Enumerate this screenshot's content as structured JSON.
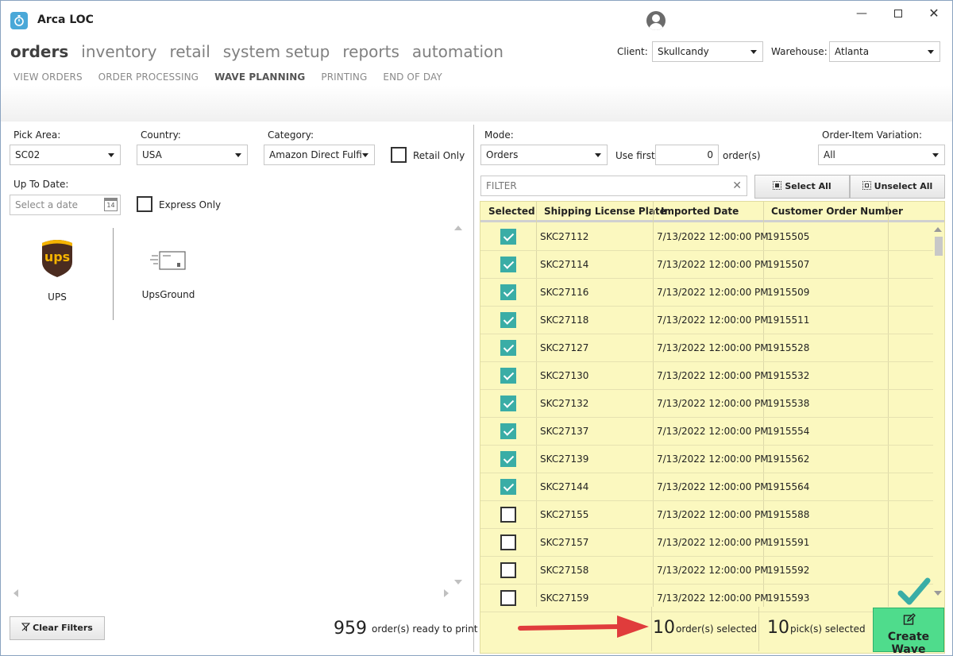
{
  "app": {
    "title": "Arca LOC"
  },
  "nav": {
    "main": [
      "orders",
      "inventory",
      "retail",
      "system setup",
      "reports",
      "automation"
    ],
    "sub": [
      "VIEW ORDERS",
      "ORDER PROCESSING",
      "WAVE PLANNING",
      "PRINTING",
      "END OF DAY"
    ]
  },
  "client": {
    "label": "Client:",
    "value": "Skullcandy"
  },
  "warehouse": {
    "label": "Warehouse:",
    "value": "Atlanta"
  },
  "filters": {
    "pick_area": {
      "label": "Pick Area:",
      "value": "SC02"
    },
    "country": {
      "label": "Country:",
      "value": "USA"
    },
    "category": {
      "label": "Category:",
      "value": "Amazon Direct Fulfi"
    },
    "retail_only": {
      "label": "Retail Only"
    },
    "up_to_date": {
      "label": "Up To Date:",
      "placeholder": "Select a date",
      "cal_day": "14"
    },
    "express_only": {
      "label": "Express Only"
    }
  },
  "carriers": [
    {
      "name": "UPS",
      "logo_text": "ups"
    },
    {
      "name": "UpsGround"
    }
  ],
  "left_footer": {
    "clear_filters": "Clear Filters",
    "ready_count": "959",
    "ready_label": "order(s) ready to print"
  },
  "mode": {
    "label": "Mode:",
    "value": "Orders"
  },
  "use_first": {
    "label": "Use first",
    "value": "0",
    "suffix": "order(s)"
  },
  "variation": {
    "label": "Order-Item Variation:",
    "value": "All"
  },
  "filter_box": {
    "placeholder": "FILTER"
  },
  "buttons": {
    "select_all": "Select All",
    "unselect_all": "Unselect All",
    "create_wave": "Create Wave"
  },
  "grid": {
    "columns": [
      "Selected",
      "Shipping License Plate",
      "Imported Date",
      "Customer Order Number"
    ],
    "rows": [
      {
        "selected": true,
        "plate": "SKC27112",
        "date": "7/13/2022 12:00:00 PM",
        "order": "1915505"
      },
      {
        "selected": true,
        "plate": "SKC27114",
        "date": "7/13/2022 12:00:00 PM",
        "order": "1915507"
      },
      {
        "selected": true,
        "plate": "SKC27116",
        "date": "7/13/2022 12:00:00 PM",
        "order": "1915509"
      },
      {
        "selected": true,
        "plate": "SKC27118",
        "date": "7/13/2022 12:00:00 PM",
        "order": "1915511"
      },
      {
        "selected": true,
        "plate": "SKC27127",
        "date": "7/13/2022 12:00:00 PM",
        "order": "1915528"
      },
      {
        "selected": true,
        "plate": "SKC27130",
        "date": "7/13/2022 12:00:00 PM",
        "order": "1915532"
      },
      {
        "selected": true,
        "plate": "SKC27132",
        "date": "7/13/2022 12:00:00 PM",
        "order": "1915538"
      },
      {
        "selected": true,
        "plate": "SKC27137",
        "date": "7/13/2022 12:00:00 PM",
        "order": "1915554"
      },
      {
        "selected": true,
        "plate": "SKC27139",
        "date": "7/13/2022 12:00:00 PM",
        "order": "1915562"
      },
      {
        "selected": true,
        "plate": "SKC27144",
        "date": "7/13/2022 12:00:00 PM",
        "order": "1915564"
      },
      {
        "selected": false,
        "plate": "SKC27155",
        "date": "7/13/2022 12:00:00 PM",
        "order": "1915588"
      },
      {
        "selected": false,
        "plate": "SKC27157",
        "date": "7/13/2022 12:00:00 PM",
        "order": "1915591"
      },
      {
        "selected": false,
        "plate": "SKC27158",
        "date": "7/13/2022 12:00:00 PM",
        "order": "1915592"
      },
      {
        "selected": false,
        "plate": "SKC27159",
        "date": "7/13/2022 12:00:00 PM",
        "order": "1915593"
      }
    ]
  },
  "summary": {
    "orders_count": "10",
    "orders_label": "order(s) selected",
    "picks_count": "10",
    "picks_label": "pick(s) selected"
  },
  "colors": {
    "accent": "#3aada6",
    "grid_bg": "#fbf8bf",
    "create_wave_bg": "#4fdc8c",
    "arrow": "#e03c3c",
    "ups_brown": "#4b2c20",
    "ups_gold": "#f5b400"
  }
}
